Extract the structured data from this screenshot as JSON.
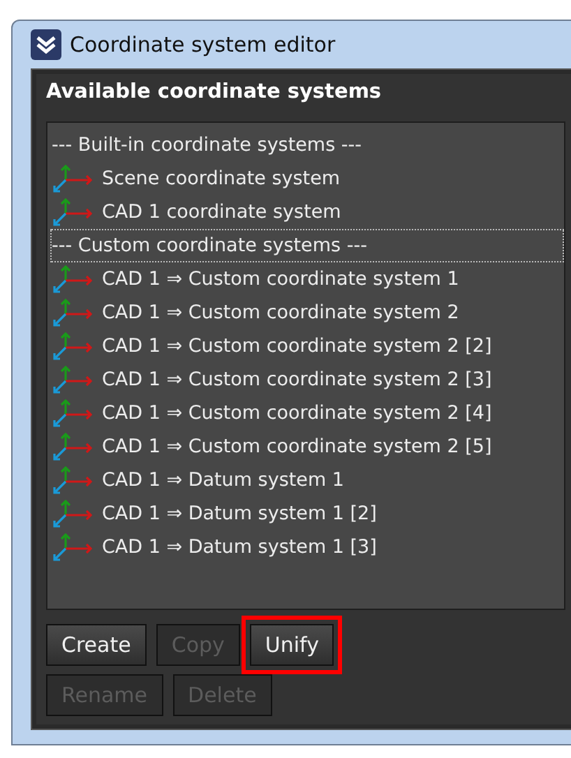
{
  "window": {
    "title": "Coordinate system editor"
  },
  "panel": {
    "title": "Available coordinate systems"
  },
  "items": [
    {
      "kind": "header",
      "label": "--- Built-in coordinate systems ---",
      "focused": false
    },
    {
      "kind": "system",
      "label": "Scene coordinate system",
      "focused": false
    },
    {
      "kind": "system",
      "label": "CAD 1 coordinate system",
      "focused": false
    },
    {
      "kind": "header",
      "label": "--- Custom coordinate systems ---",
      "focused": true
    },
    {
      "kind": "system",
      "label": "CAD 1 ⇒ Custom coordinate system 1",
      "focused": false
    },
    {
      "kind": "system",
      "label": "CAD 1 ⇒ Custom coordinate system 2",
      "focused": false
    },
    {
      "kind": "system",
      "label": "CAD 1 ⇒ Custom coordinate system 2 [2]",
      "focused": false
    },
    {
      "kind": "system",
      "label": "CAD 1 ⇒ Custom coordinate system 2 [3]",
      "focused": false
    },
    {
      "kind": "system",
      "label": "CAD 1 ⇒ Custom coordinate system 2 [4]",
      "focused": false
    },
    {
      "kind": "system",
      "label": "CAD 1 ⇒ Custom coordinate system 2 [5]",
      "focused": false
    },
    {
      "kind": "system",
      "label": "CAD 1 ⇒ Datum system 1",
      "focused": false
    },
    {
      "kind": "system",
      "label": "CAD 1 ⇒ Datum system 1 [2]",
      "focused": false
    },
    {
      "kind": "system",
      "label": "CAD 1 ⇒ Datum system 1 [3]",
      "focused": false
    }
  ],
  "button_rows": [
    [
      {
        "label": "Create",
        "disabled": false,
        "highlighted": false
      },
      {
        "label": "Copy",
        "disabled": true,
        "highlighted": false
      },
      {
        "label": "Unify",
        "disabled": false,
        "highlighted": true
      }
    ],
    [
      {
        "label": "Rename",
        "disabled": true,
        "highlighted": false
      },
      {
        "label": "Delete",
        "disabled": true,
        "highlighted": false
      }
    ]
  ]
}
